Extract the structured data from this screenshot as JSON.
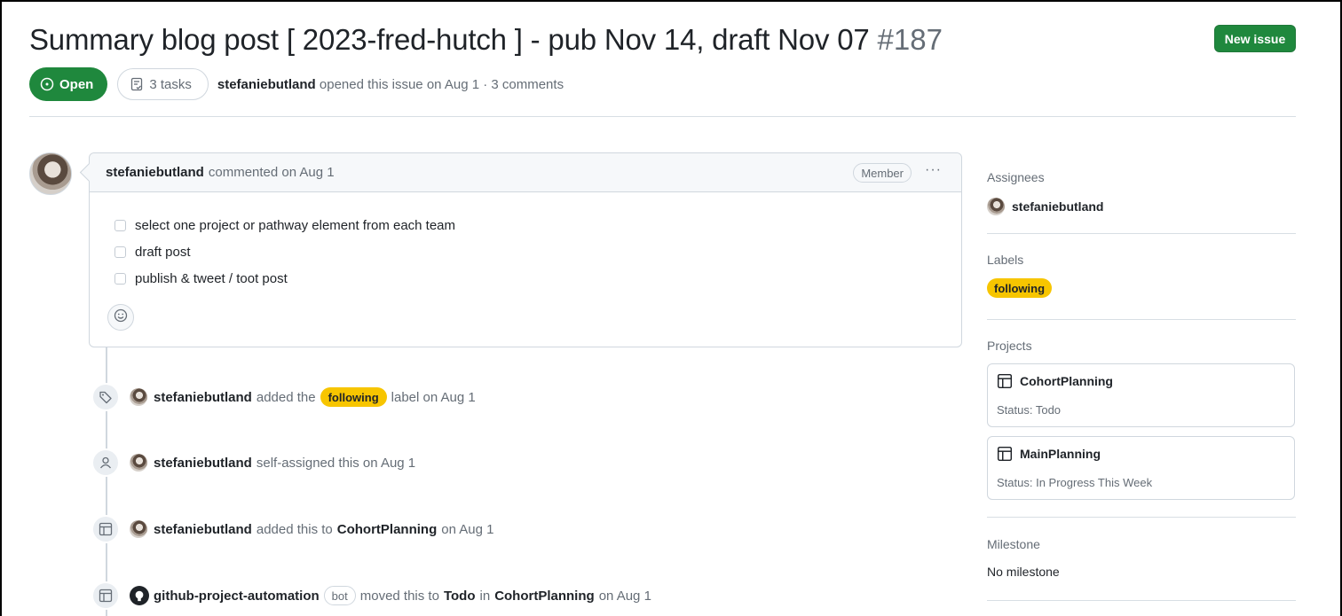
{
  "issue": {
    "title": "Summary blog post [ 2023-fred-hutch ] - pub Nov 14, draft Nov 07",
    "number": "#187",
    "state": "Open",
    "tasks": "3 tasks",
    "author": "stefaniebutland",
    "opened_text": "opened this issue on Aug 1 · 3 comments"
  },
  "header": {
    "new_issue_label": "New issue"
  },
  "comment": {
    "author": "stefaniebutland",
    "action": "commented on Aug 1",
    "role": "Member",
    "tasks": [
      "select one project or pathway element from each team",
      "draft post",
      "publish & tweet / toot post"
    ]
  },
  "timeline": {
    "label_event": {
      "actor": "stefaniebutland",
      "before": "added the",
      "label": "following",
      "after": "label on Aug 1"
    },
    "assign_event": {
      "actor": "stefaniebutland",
      "text": "self-assigned this on Aug 1"
    },
    "project_event": {
      "actor": "stefaniebutland",
      "before": "added this to",
      "project": "CohortPlanning",
      "after": "on Aug 1"
    },
    "move_event": {
      "actor": "github-project-automation",
      "badge": "bot",
      "before": "moved this to",
      "column": "Todo",
      "middle": "in",
      "project": "CohortPlanning",
      "after": "on Aug 1"
    }
  },
  "sidebar": {
    "assignees_heading": "Assignees",
    "assignee": "stefaniebutland",
    "labels_heading": "Labels",
    "label": "following",
    "projects_heading": "Projects",
    "projects": [
      {
        "name": "CohortPlanning",
        "status": "Status: Todo"
      },
      {
        "name": "MainPlanning",
        "status": "Status: In Progress This Week"
      }
    ],
    "milestone_heading": "Milestone",
    "milestone": "No milestone"
  },
  "colors": {
    "open_green": "#1f883d",
    "label_yellow": "#f7c500",
    "muted_text": "#656d76",
    "border": "#d0d7de"
  },
  "icons": [
    "issue-opened-icon",
    "tasklist-icon",
    "kebab-horizontal-icon",
    "smiley-icon",
    "tag-icon",
    "person-icon",
    "table-icon",
    "github-mark-icon"
  ]
}
